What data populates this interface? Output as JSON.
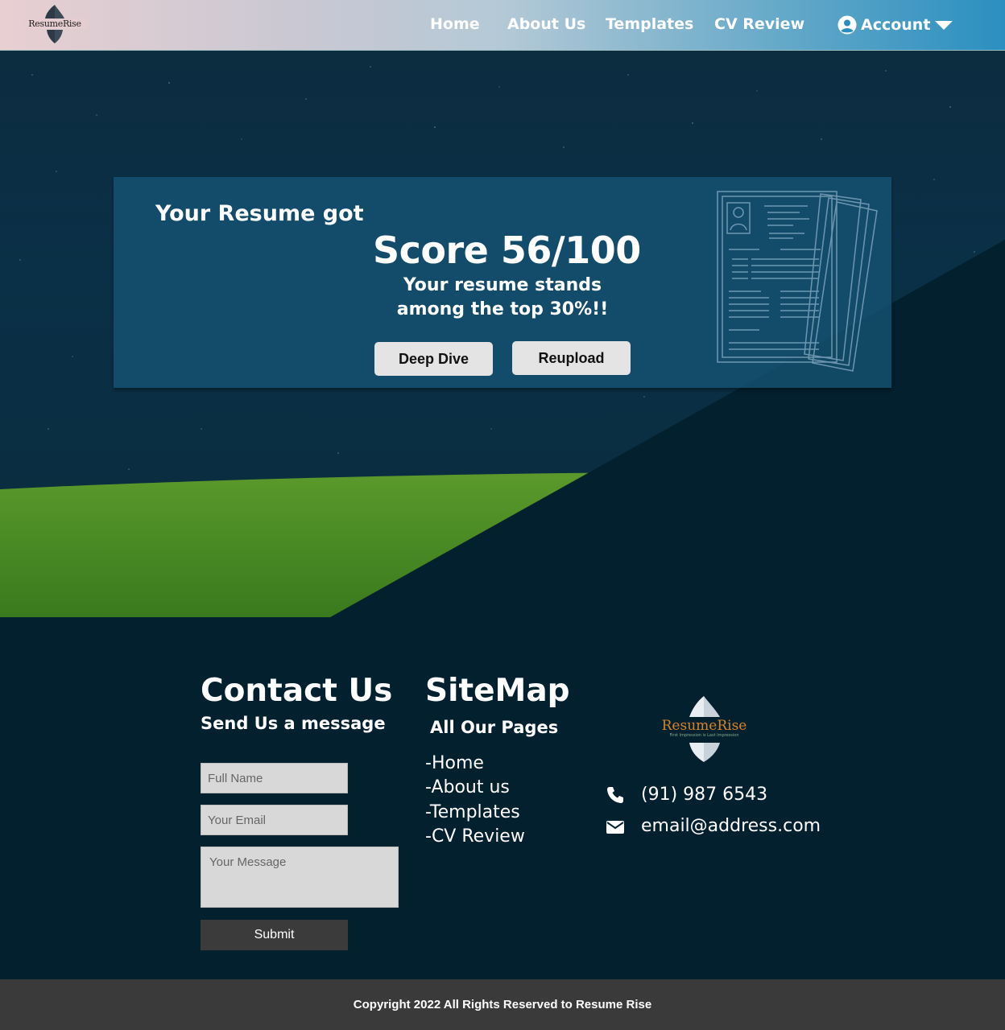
{
  "brand": {
    "name": "ResumeRise",
    "tagline": "First Impression is Last Impression"
  },
  "nav": {
    "items": [
      {
        "label": "Home"
      },
      {
        "label": "About Us"
      },
      {
        "label": "Templates"
      },
      {
        "label": "CV Review"
      }
    ],
    "account_label": "Account"
  },
  "result": {
    "lead": "Your Resume got",
    "score": "Score 56/100",
    "standing": "Your resume stands among the top 30%!!",
    "score_value": 56,
    "score_max": 100,
    "buttons": {
      "deep_dive": "Deep Dive",
      "reupload": "Reupload"
    }
  },
  "contact_form": {
    "title": "Contact Us",
    "subtitle": "Send Us a message",
    "name_placeholder": "Full Name",
    "email_placeholder": "Your Email",
    "message_placeholder": "Your Message",
    "submit_label": "Submit"
  },
  "sitemap": {
    "title": "SiteMap",
    "subtitle": "All Our Pages",
    "items": [
      {
        "label": "-Home"
      },
      {
        "label": "-About us"
      },
      {
        "label": "-Templates"
      },
      {
        "label": "-CV Review"
      }
    ]
  },
  "contact_info": {
    "phone": "(91) 987 6543",
    "email": "email@address.com"
  },
  "footer": {
    "copyright": "Copyright 2022 All Rights Reserved to Resume Rise"
  },
  "colors": {
    "nav_gradient_start": "#e8cfd2",
    "nav_gradient_end": "#2b8fc0",
    "page_dark": "#03202f",
    "card_blue": "#165474",
    "brand_orange": "#d9832a",
    "grass_green": "#4a8a24",
    "footer_bar": "#3a3a3a"
  },
  "icons": [
    "logo-mark-icon",
    "user-circle-icon",
    "caret-down-icon",
    "resume-document-icon",
    "phone-icon",
    "envelope-icon"
  ]
}
